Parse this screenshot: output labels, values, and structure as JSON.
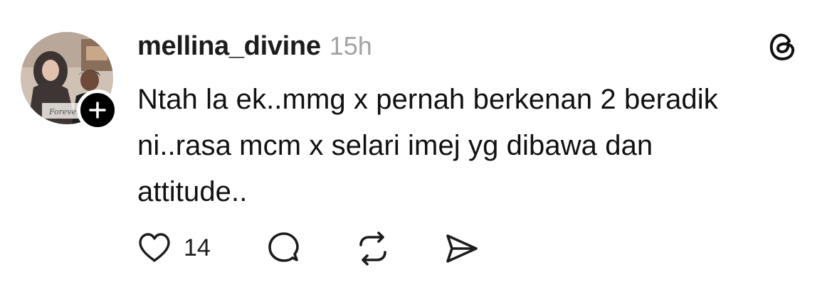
{
  "post": {
    "username": "mellina_divine",
    "timestamp": "15h",
    "body_lines": [
      "Ntah la ek..mmg x pernah berkenan 2 beradik",
      "ni..rasa mcm x selari imej yg dibawa dan",
      "attitude.."
    ],
    "avatar_caption": "Forever",
    "like_count": "14",
    "icons": {
      "avatar": "profile-photo",
      "follow": "plus-icon",
      "brand": "threads-logo-icon",
      "like": "heart-icon",
      "reply": "comment-bubble-icon",
      "repost": "repost-arrows-icon",
      "share": "send-icon"
    },
    "colors": {
      "text": "#111111",
      "muted": "#a3a3a3",
      "badge": "#000000"
    }
  }
}
